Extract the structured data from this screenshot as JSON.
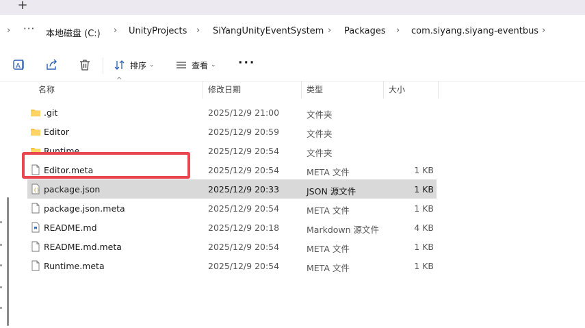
{
  "tabstrip": {
    "new_tab": "+"
  },
  "breadcrumb": {
    "overflow": "···",
    "items": [
      "本地磁盘 (C:)",
      "UnityProjects",
      "SiYangUnityEventSystem",
      "Packages",
      "com.siyang.siyang-eventbus"
    ]
  },
  "toolbar": {
    "sort_label": "排序",
    "view_label": "查看",
    "more_label": "···"
  },
  "columns": {
    "name": "名称",
    "date": "修改日期",
    "type": "类型",
    "size": "大小"
  },
  "rows": [
    {
      "name": ".git",
      "date": "2025/12/9 21:00",
      "type": "文件夹",
      "size": "",
      "icon": "folder-icon"
    },
    {
      "name": "Editor",
      "date": "2025/12/9 20:59",
      "type": "文件夹",
      "size": "",
      "icon": "folder-icon"
    },
    {
      "name": "Runtime",
      "date": "2025/12/9 20:54",
      "type": "文件夹",
      "size": "",
      "icon": "folder-icon"
    },
    {
      "name": "Editor.meta",
      "date": "2025/12/9 20:54",
      "type": "META 文件",
      "size": "1 KB",
      "icon": "file-icon"
    },
    {
      "name": "package.json",
      "date": "2025/12/9 20:33",
      "type": "JSON 源文件",
      "size": "1 KB",
      "icon": "json-file-icon",
      "selected": true
    },
    {
      "name": "package.json.meta",
      "date": "2025/12/9 20:54",
      "type": "META 文件",
      "size": "1 KB",
      "icon": "file-icon"
    },
    {
      "name": "README.md",
      "date": "2025/12/9 20:18",
      "type": "Markdown 源文件",
      "size": "4 KB",
      "icon": "markdown-file-icon"
    },
    {
      "name": "README.md.meta",
      "date": "2025/12/9 20:54",
      "type": "META 文件",
      "size": "1 KB",
      "icon": "file-icon"
    },
    {
      "name": "Runtime.meta",
      "date": "2025/12/9 20:54",
      "type": "META 文件",
      "size": "1 KB",
      "icon": "file-icon"
    }
  ],
  "colors": {
    "highlight": "#e8474f",
    "selected_row": "#d9d9d9",
    "folder": "#f5c242"
  }
}
